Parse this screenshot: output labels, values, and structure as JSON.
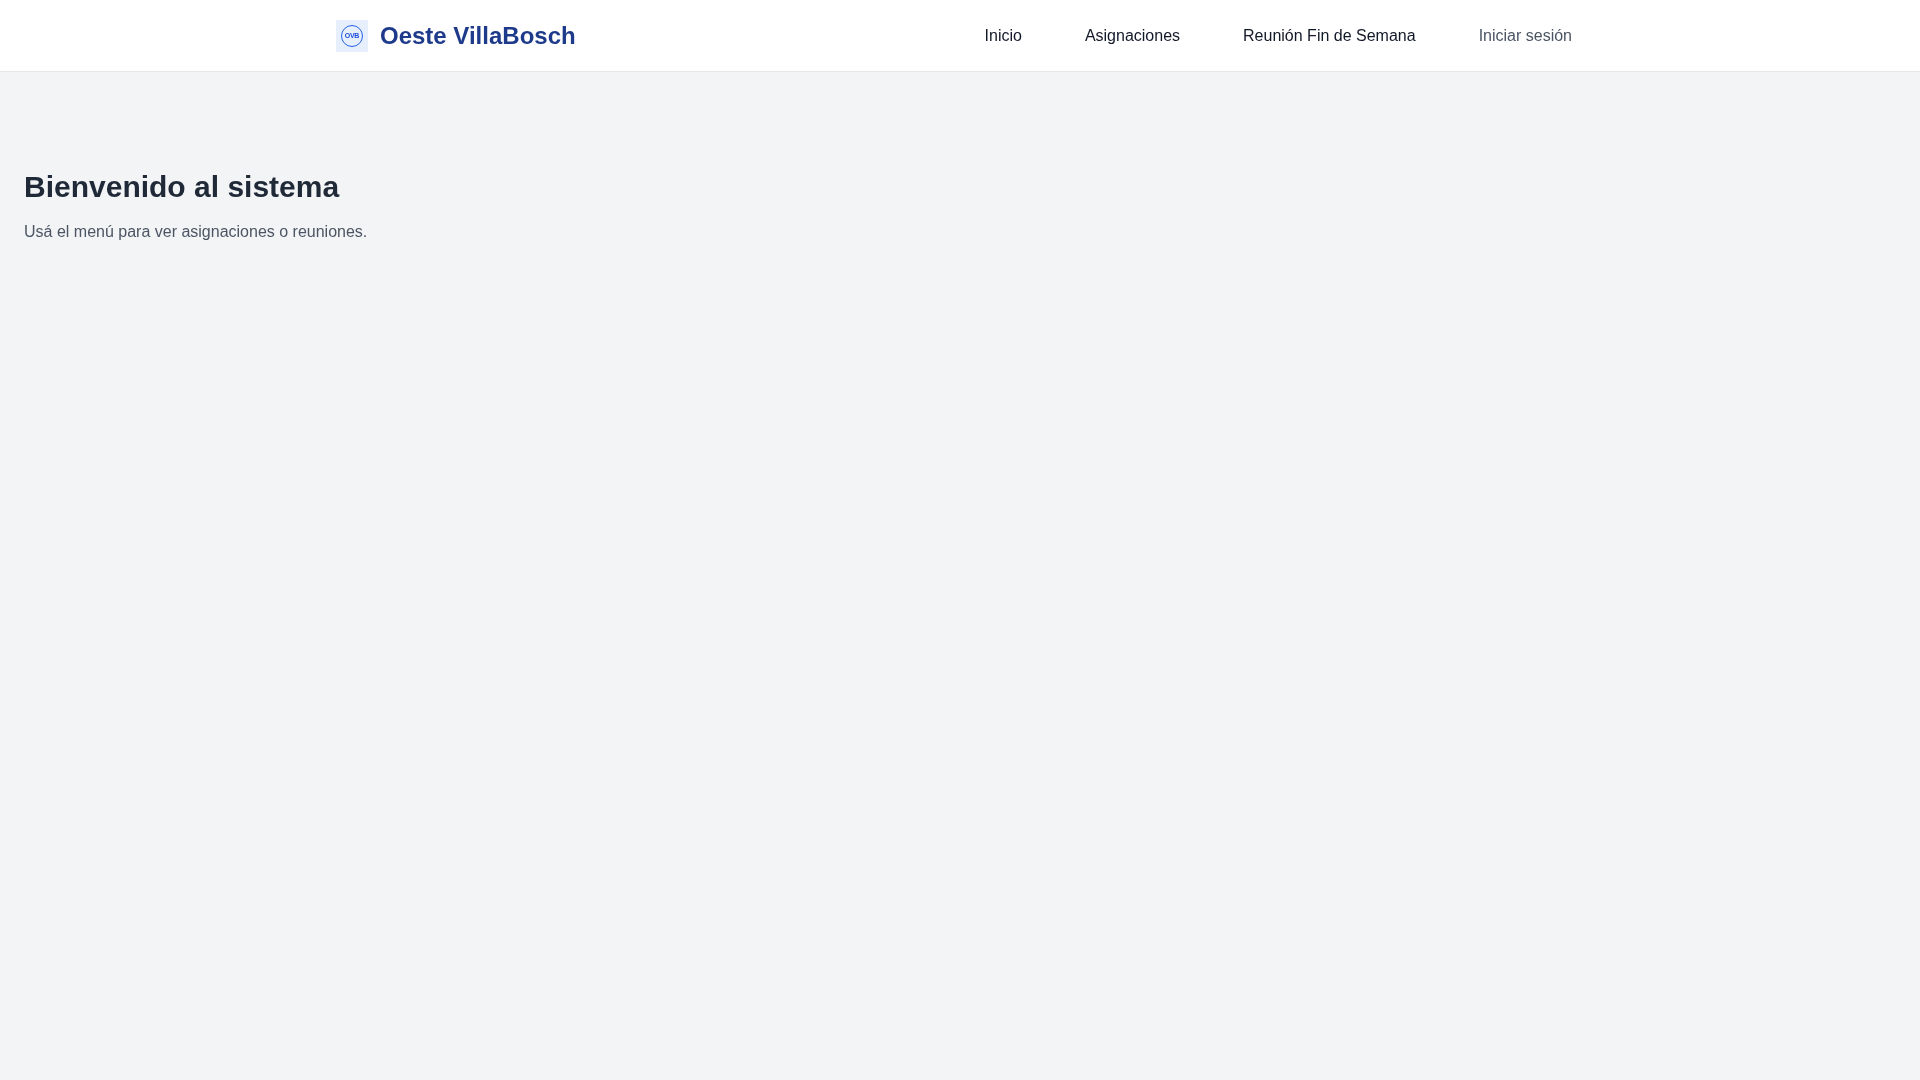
{
  "header": {
    "logo": {
      "monogram": "OVB"
    },
    "brand": "Oeste VillaBosch",
    "nav": [
      "Inicio",
      "Asignaciones",
      "Reunión Fin de Semana"
    ],
    "login": {
      "label": "Iniciar sesión"
    }
  },
  "main": {
    "title": "Bienvenido al sistema",
    "subtitle": "Usá el menú para ver asignaciones o reuniones."
  }
}
